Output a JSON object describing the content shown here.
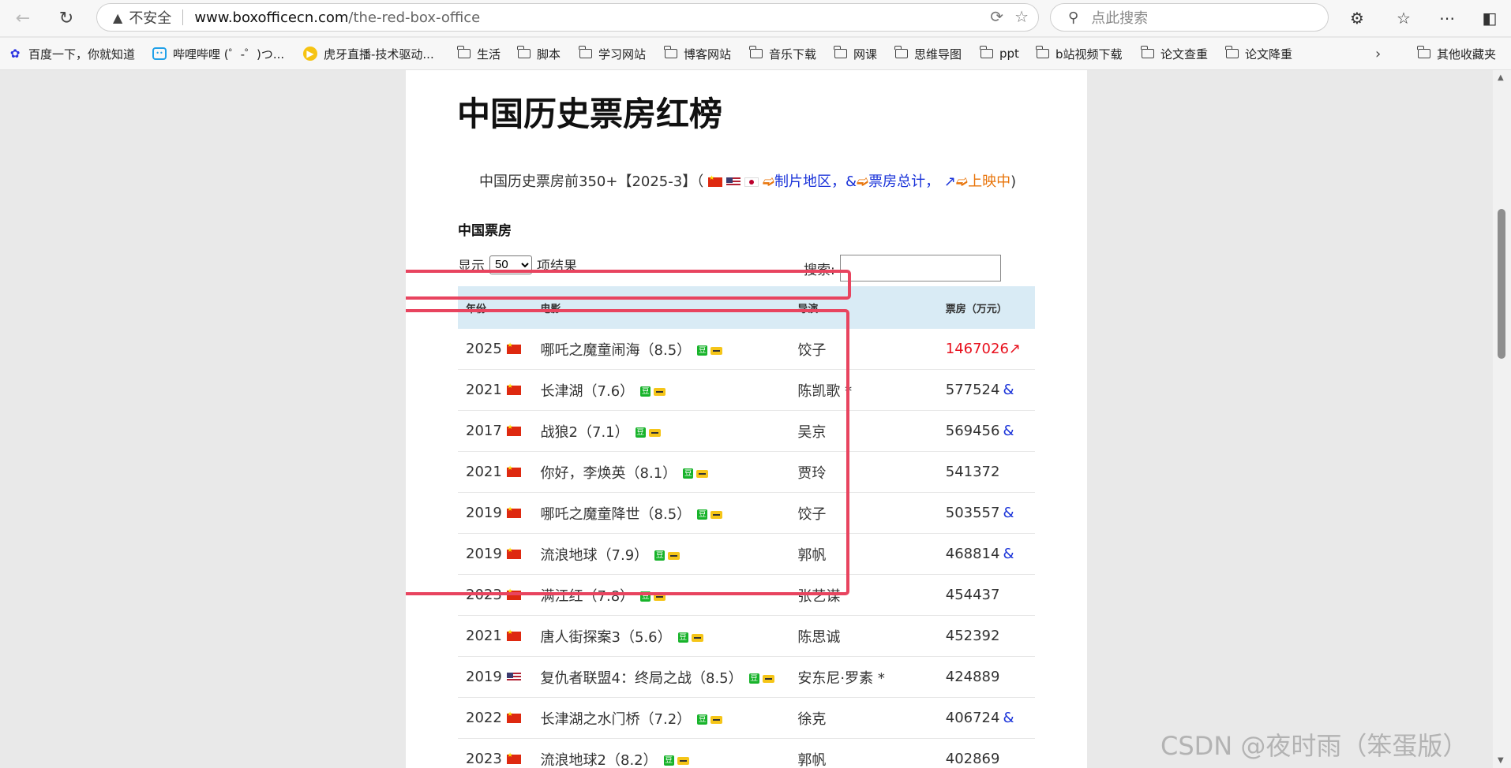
{
  "browser": {
    "back_icon": "arrow-left-icon",
    "refresh_icon": "refresh-icon",
    "insecure_label": "不安全",
    "url_host": "www.boxofficecn.com",
    "url_path": "/the-red-box-office",
    "search_placeholder": "点此搜索",
    "bookmarks": [
      {
        "label": "百度一下，你就知道",
        "icon": "baidu-paw-icon"
      },
      {
        "label": "哔哩哔哩 (゜-゜)つ...",
        "icon": "bilibili-tv-icon"
      },
      {
        "label": "虎牙直播-技术驱动...",
        "icon": "huya-icon"
      },
      {
        "label": "生活",
        "icon": "folder-icon"
      },
      {
        "label": "脚本",
        "icon": "folder-icon"
      },
      {
        "label": "学习网站",
        "icon": "folder-icon"
      },
      {
        "label": "博客网站",
        "icon": "folder-icon"
      },
      {
        "label": "音乐下载",
        "icon": "folder-icon"
      },
      {
        "label": "网课",
        "icon": "folder-icon"
      },
      {
        "label": "思维导图",
        "icon": "folder-icon"
      },
      {
        "label": "ppt",
        "icon": "folder-icon"
      },
      {
        "label": "b站视频下载",
        "icon": "folder-icon"
      },
      {
        "label": "论文查重",
        "icon": "folder-icon"
      },
      {
        "label": "论文降重",
        "icon": "folder-icon"
      }
    ],
    "other_bookmarks": "其他收藏夹"
  },
  "page": {
    "title": "中国历史票房红榜",
    "intro_text": "中国历史票房前350+【2025-3】（",
    "intro_region": "制片地区，",
    "intro_amp": "&",
    "intro_total": "票房总计，",
    "intro_arrow": "↗",
    "intro_showing": "上映中",
    "intro_close": ")",
    "section_title": "中国票房",
    "length_prefix": "显示",
    "length_value": "50",
    "length_suffix": "项结果",
    "search_label": "搜索:"
  },
  "table": {
    "headers": [
      "年份",
      "电影",
      "导演",
      "票房（万元）"
    ],
    "rows": [
      {
        "year": "2025",
        "flag": "cn",
        "film": "哪吒之魔童闹海（8.5）",
        "director": "饺子",
        "box": "1467026",
        "suffix": "↗"
      },
      {
        "year": "2021",
        "flag": "cn",
        "film": "长津湖（7.6）",
        "director": "陈凯歌 *",
        "box": "577524",
        "suffix": "&"
      },
      {
        "year": "2017",
        "flag": "cn",
        "film": "战狼2（7.1）",
        "director": "吴京",
        "box": "569456",
        "suffix": "&"
      },
      {
        "year": "2021",
        "flag": "cn",
        "film": "你好，李焕英（8.1）",
        "director": "贾玲",
        "box": "541372",
        "suffix": ""
      },
      {
        "year": "2019",
        "flag": "cn",
        "film": "哪吒之魔童降世（8.5）",
        "director": "饺子",
        "box": "503557",
        "suffix": "&"
      },
      {
        "year": "2019",
        "flag": "cn",
        "film": "流浪地球（7.9）",
        "director": "郭帆",
        "box": "468814",
        "suffix": "&"
      },
      {
        "year": "2023",
        "flag": "cn",
        "film": "满江红（7.8）",
        "director": "张艺谋",
        "box": "454437",
        "suffix": ""
      },
      {
        "year": "2021",
        "flag": "cn",
        "film": "唐人街探案3（5.6）",
        "director": "陈思诚",
        "box": "452392",
        "suffix": ""
      },
      {
        "year": "2019",
        "flag": "us",
        "film": "复仇者联盟4：终局之战（8.5）",
        "director": "安东尼·罗素 *",
        "box": "424889",
        "suffix": ""
      },
      {
        "year": "2022",
        "flag": "cn",
        "film": "长津湖之水门桥（7.2）",
        "director": "徐克",
        "box": "406724",
        "suffix": "&"
      },
      {
        "year": "2023",
        "flag": "cn",
        "film": "流浪地球2（8.2）",
        "director": "郭帆",
        "box": "402869",
        "suffix": ""
      }
    ]
  },
  "watermark": "CSDN @夜时雨（笨蛋版）"
}
